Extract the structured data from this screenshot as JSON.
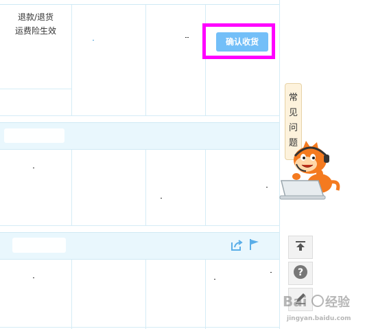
{
  "order": {
    "refund_line1": "退款/退货",
    "refund_line2": "运费险生效",
    "confirm_button": "确认收货"
  },
  "faq": {
    "chars": [
      "常",
      "见",
      "问",
      "题"
    ]
  },
  "sidebar": {
    "icons": [
      "back-to-top-icon",
      "help-icon",
      "feedback-icon"
    ]
  },
  "colors": {
    "accent": "#73bff8",
    "highlight": "#ff00ff",
    "band": "#e9f7fd",
    "grid": "#d4ecf6"
  }
}
